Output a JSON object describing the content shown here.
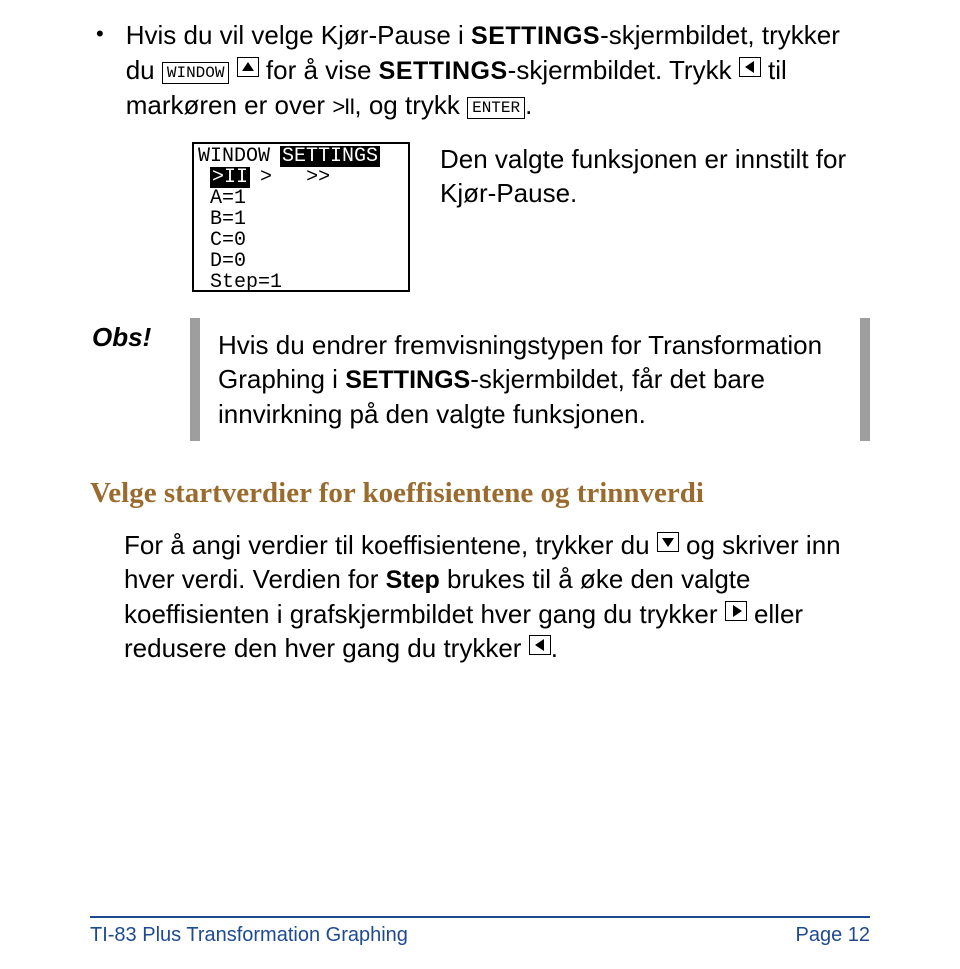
{
  "bullet": {
    "part1": "Hvis du vil velge Kjør-Pause i ",
    "settings1": "SETTINGS",
    "part2": "-skjermbildet, trykker du ",
    "key_window": "WINDOW",
    "part3": " for å vise ",
    "settings2": "SETTINGS",
    "part4": "-skjermbildet. Trykk ",
    "part5": " til markøren er over ",
    "play_pause": ">II",
    "part6": ", og trykk ",
    "key_enter": "ENTER",
    "part7": "."
  },
  "calc": {
    "hdr_left": "WINDOW",
    "hdr_right": "SETTINGS",
    "row2_sel": ">II",
    "row2_opt1": ">",
    "row2_opt2": ">>",
    "row3": "A=1",
    "row4": "B=1",
    "row5": "C=0",
    "row6": "D=0",
    "row7": "Step=1"
  },
  "screen_caption": "Den valgte funksjonen er innstilt for Kjør-Pause.",
  "obs": {
    "label": "Obs!",
    "part1": "Hvis du endrer fremvisningstypen for Transformation Graphing i ",
    "settings": "SETTINGS",
    "part2": "-skjermbildet, får det bare innvirkning på den valgte funksjonen."
  },
  "section_title": "Velge startverdier for koeffisientene og trinnverdi",
  "body": {
    "part1": "For å angi verdier til koeffisientene, trykker du ",
    "part2": " og skriver inn hver verdi. Verdien for ",
    "step": "Step",
    "part3": " brukes til å øke den valgte koeffisienten i grafskjermbildet hver gang du trykker ",
    "part4": " eller redusere den hver gang du trykker ",
    "part5": "."
  },
  "footer": {
    "left": "TI-83 Plus Transformation Graphing",
    "right": "Page 12"
  }
}
